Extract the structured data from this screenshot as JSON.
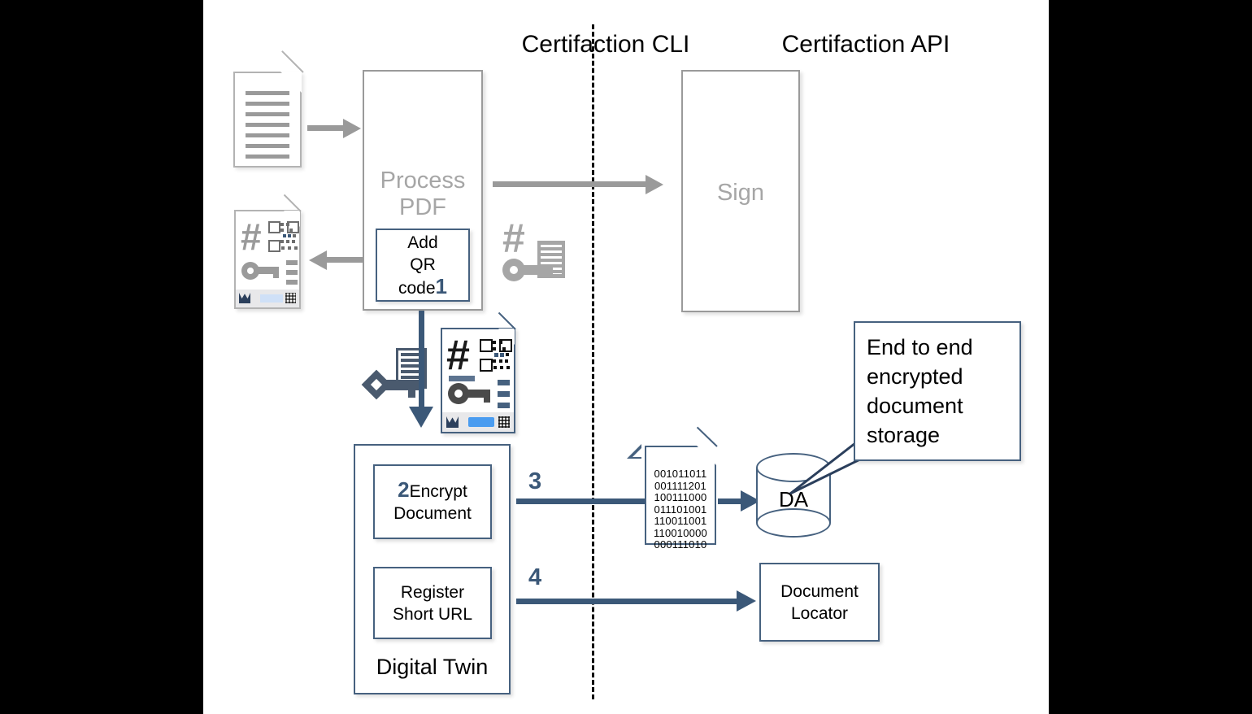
{
  "diagram": {
    "lanes": [
      {
        "id": "cli",
        "title": "Certifaction CLI"
      },
      {
        "id": "api",
        "title": "Certifaction API"
      }
    ],
    "boxes": {
      "process_pdf": "Process\nPDF",
      "process_pdf_line1": "Process",
      "process_pdf_line2": "PDF",
      "add_qr": "Add\nQR\ncode",
      "add_qr_line1": "Add",
      "add_qr_line2": "QR",
      "add_qr_line3": "code",
      "add_qr_step": "1",
      "sign": "Sign",
      "encrypt_step": "2",
      "encrypt_line1": "Encrypt",
      "encrypt_line2": "Document",
      "register_line1": "Register",
      "register_line2": "Short URL",
      "digital_twin": "Digital Twin",
      "document_locator_line1": "Document",
      "document_locator_line2": "Locator"
    },
    "arrows": {
      "step3": "3",
      "step4": "4"
    },
    "database": {
      "label": "DA"
    },
    "callout": {
      "line1": "End to end",
      "line2": "encrypted",
      "line3": "document",
      "line4": "storage"
    },
    "binary_document": {
      "rows": [
        "001011011",
        "001111201",
        "100111000",
        "011101001",
        "110011001",
        "110010000",
        "000111010"
      ]
    },
    "icons": {
      "source_document": "document-icon",
      "signed_document_small": "signed-document-qr-icon",
      "signed_document_large": "signed-document-qr-icon",
      "hash_key_document_gray": "hash-key-document-icon",
      "key_document_blue": "key-document-icon"
    },
    "hash_symbol": "#",
    "colors": {
      "accent_blue": "#3b5878",
      "border_blue": "#46617f",
      "gray_stroke": "#9a9a9a",
      "gray_text": "#a6a6a6",
      "light_gray": "#b3b3b3",
      "qr_blue": "#4a9cf0",
      "canvas": "#ffffff",
      "letterbox": "#000000"
    }
  }
}
